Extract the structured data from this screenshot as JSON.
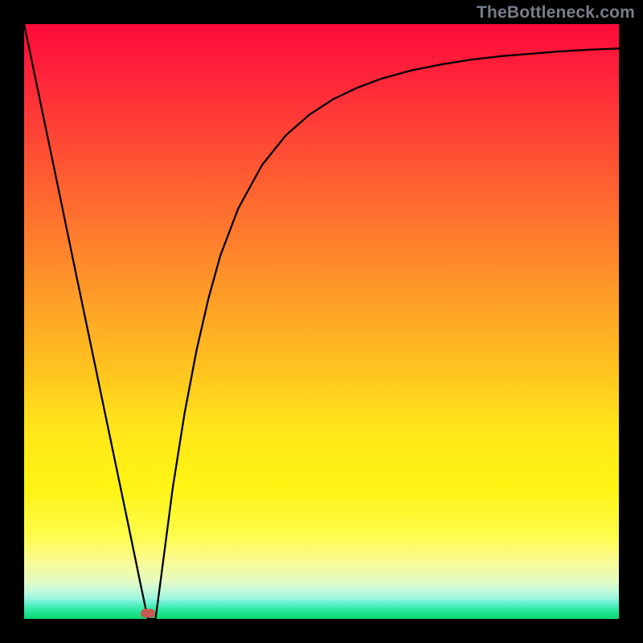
{
  "watermark": "TheBottleneck.com",
  "marker": {
    "x_pct": 20.8,
    "y_pct": 99.0,
    "color": "#c85a54"
  },
  "chart_data": {
    "type": "line",
    "title": "",
    "xlabel": "",
    "ylabel": "",
    "xlim": [
      0,
      100
    ],
    "ylim": [
      0,
      100
    ],
    "grid": false,
    "legend": false,
    "annotations": [],
    "background_gradient_stops": [
      {
        "pct": 0,
        "color": "#ff0a3a"
      },
      {
        "pct": 7,
        "color": "#ff1f3a"
      },
      {
        "pct": 17,
        "color": "#ff3f36"
      },
      {
        "pct": 30,
        "color": "#ff6a2f"
      },
      {
        "pct": 45,
        "color": "#ff9a28"
      },
      {
        "pct": 58,
        "color": "#ffc31f"
      },
      {
        "pct": 68,
        "color": "#ffe61a"
      },
      {
        "pct": 78,
        "color": "#fff414"
      },
      {
        "pct": 86,
        "color": "#fefc4a"
      },
      {
        "pct": 90,
        "color": "#fbfb8f"
      },
      {
        "pct": 93.5,
        "color": "#e6fbbf"
      },
      {
        "pct": 95,
        "color": "#c9fad7"
      },
      {
        "pct": 96.5,
        "color": "#9ef6e0"
      },
      {
        "pct": 97.5,
        "color": "#5df0ca"
      },
      {
        "pct": 98.5,
        "color": "#2ae8a0"
      },
      {
        "pct": 100,
        "color": "#0bd872"
      }
    ],
    "series": [
      {
        "name": "bottleneck-curve",
        "x": [
          0.0,
          2.0,
          4.0,
          6.0,
          8.0,
          10.0,
          12.0,
          14.0,
          16.0,
          18.0,
          19.5,
          20.8,
          22.1,
          23.0,
          25.0,
          27.0,
          29.0,
          31.0,
          33.0,
          36.0,
          40.0,
          44.0,
          48.0,
          52.0,
          56.0,
          60.0,
          65.0,
          70.0,
          75.0,
          80.0,
          85.0,
          90.0,
          95.0,
          100.0
        ],
        "y": [
          100.0,
          90.4,
          80.8,
          71.2,
          61.5,
          51.9,
          42.3,
          32.7,
          23.1,
          13.5,
          6.2,
          0.0,
          0.0,
          6.8,
          22.1,
          34.7,
          45.2,
          53.9,
          61.1,
          69.0,
          76.3,
          81.3,
          84.8,
          87.4,
          89.3,
          90.8,
          92.2,
          93.2,
          94.0,
          94.6,
          95.0,
          95.4,
          95.7,
          95.9
        ]
      }
    ],
    "min_marker": {
      "x": 20.8,
      "y": 0.0
    }
  }
}
